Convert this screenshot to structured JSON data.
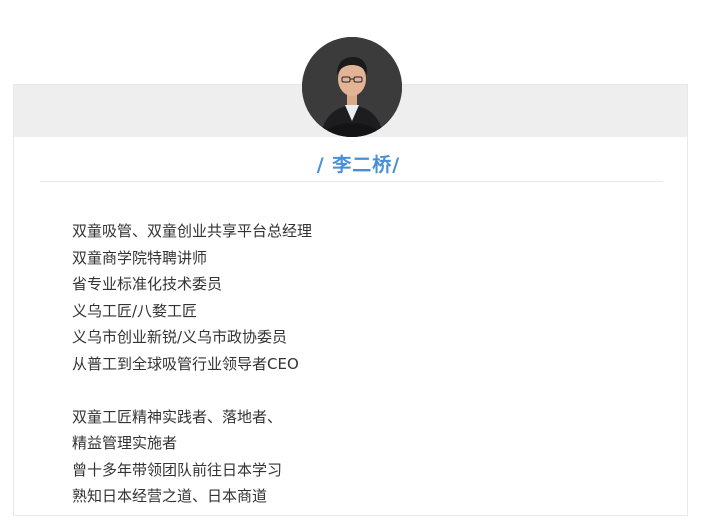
{
  "profile": {
    "name": "/ 李二桥/",
    "bio_group_1": [
      "双童吸管、双童创业共享平台总经理",
      "双童商学院特聘讲师",
      "省专业标准化技术委员",
      "义乌工匠/八婺工匠",
      "义乌市创业新锐/义乌市政协委员",
      "从普工到全球吸管行业领导者CEO"
    ],
    "bio_group_2": [
      "双童工匠精神实践者、落地者、",
      "精益管理实施者",
      "曾十多年带领团队前往日本学习",
      "熟知日本经营之道、日本商道"
    ]
  },
  "colors": {
    "accent": "#4a8fd6",
    "band": "#eeeeee",
    "text": "#333333"
  }
}
